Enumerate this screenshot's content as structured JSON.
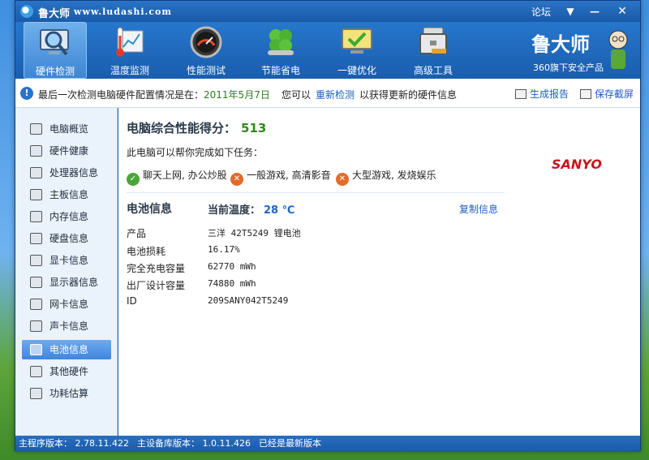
{
  "window": {
    "title": "鲁大师",
    "url": "www.ludashi.com",
    "forum": "论坛",
    "menu_glyph": "▼",
    "min_glyph": "—",
    "close_glyph": "✕"
  },
  "toolbar": {
    "items": [
      {
        "label": "硬件检测",
        "icon": "magnifier-monitor-icon"
      },
      {
        "label": "温度监测",
        "icon": "thermometer-icon"
      },
      {
        "label": "性能测试",
        "icon": "gauge-icon"
      },
      {
        "label": "节能省电",
        "icon": "clover-icon"
      },
      {
        "label": "一键优化",
        "icon": "monitor-checkmark-icon"
      },
      {
        "label": "高级工具",
        "icon": "toolbox-icon"
      }
    ],
    "active_index": 0
  },
  "brand": {
    "title": "鲁大师",
    "subtitle": "360旗下安全产品"
  },
  "infobar": {
    "text_prefix": "最后一次检测电脑硬件配置情况是在：",
    "date": "2011年5月7日",
    "you_can": "您可以",
    "redetect": "重新检测",
    "suffix": "以获得更新的硬件信息",
    "report": "生成报告",
    "save": "保存截屏"
  },
  "sidebar": {
    "items": [
      {
        "label": "电脑概览",
        "icon": "computer-overview-icon"
      },
      {
        "label": "硬件健康",
        "icon": "plus-health-icon"
      },
      {
        "label": "处理器信息",
        "icon": "cpu-icon"
      },
      {
        "label": "主板信息",
        "icon": "motherboard-icon"
      },
      {
        "label": "内存信息",
        "icon": "memory-icon"
      },
      {
        "label": "硬盘信息",
        "icon": "harddisk-icon"
      },
      {
        "label": "显卡信息",
        "icon": "graphics-card-icon"
      },
      {
        "label": "显示器信息",
        "icon": "display-icon"
      },
      {
        "label": "网卡信息",
        "icon": "network-card-icon"
      },
      {
        "label": "声卡信息",
        "icon": "sound-card-icon"
      },
      {
        "label": "电池信息",
        "icon": "battery-icon"
      },
      {
        "label": "其他硬件",
        "icon": "other-hardware-icon"
      },
      {
        "label": "功耗估算",
        "icon": "power-estimate-icon"
      }
    ],
    "active_index": 10
  },
  "main": {
    "score_label": "电脑综合性能得分：",
    "score_value": "513",
    "tasks_intro": "此电脑可以帮你完成如下任务：",
    "tasks": [
      {
        "label": "聊天上网, 办公炒股",
        "status": "ok"
      },
      {
        "label": "一般游戏, 高清影音",
        "status": "no"
      },
      {
        "label": "大型游戏, 发烧娱乐",
        "status": "no"
      }
    ],
    "brand_logo": "SANYO",
    "battery_title": "电池信息",
    "temp_label": "当前温度：",
    "temp_value": "28 ℃",
    "copy": "复制信息",
    "props": [
      {
        "label": "产品",
        "value": "三洋 42T5249 锂电池"
      },
      {
        "label": "电池损耗",
        "value": "16.17%"
      },
      {
        "label": "完全充电容量",
        "value": "62770 mWh"
      },
      {
        "label": "出厂设计容量",
        "value": "74880 mWh"
      },
      {
        "label": "ID",
        "value": "209SANY042T5249"
      }
    ]
  },
  "status": {
    "main_version": "主程序版本：  2.78.11.422",
    "db_version": "主设备库版本：  1.0.11.426",
    "latest": "已经是最新版本"
  },
  "colors": {
    "accent": "#1b5fae",
    "score_green": "#2e8b1c",
    "sanyo_red": "#c4161c"
  }
}
